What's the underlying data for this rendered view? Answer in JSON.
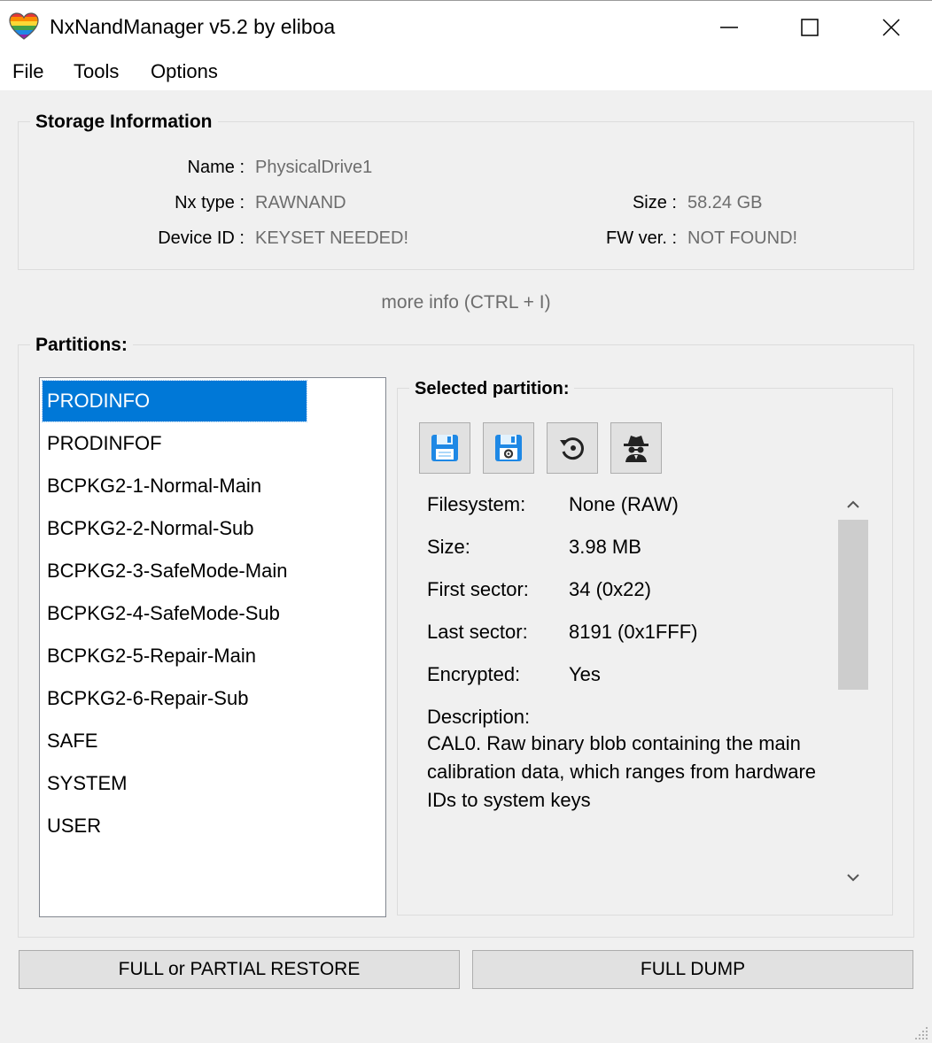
{
  "window": {
    "title": "NxNandManager v5.2 by eliboa",
    "icon": "rainbow-heart-icon"
  },
  "menu": {
    "items": [
      "File",
      "Tools",
      "Options"
    ]
  },
  "storage": {
    "title": "Storage Information",
    "name_label": "Name :",
    "name_value": "PhysicalDrive1",
    "nxtype_label": "Nx type :",
    "nxtype_value": "RAWNAND",
    "deviceid_label": "Device ID :",
    "deviceid_value": "KEYSET NEEDED!",
    "size_label": "Size :",
    "size_value": "58.24 GB",
    "fw_label": "FW ver. :",
    "fw_value": "NOT FOUND!"
  },
  "more_info": "more info (CTRL + I)",
  "partitions": {
    "title": "Partitions:",
    "items": [
      "PRODINFO",
      "PRODINFOF",
      "BCPKG2-1-Normal-Main",
      "BCPKG2-2-Normal-Sub",
      "BCPKG2-3-SafeMode-Main",
      "BCPKG2-4-SafeMode-Sub",
      "BCPKG2-5-Repair-Main",
      "BCPKG2-6-Repair-Sub",
      "SAFE",
      "SYSTEM",
      "USER"
    ],
    "selected_index": 0
  },
  "selected": {
    "title": "Selected partition:",
    "toolbar_icons": [
      "save-icon",
      "save-settings-icon",
      "restore-icon",
      "incognito-icon"
    ],
    "filesystem_label": "Filesystem:",
    "filesystem_value": "None (RAW)",
    "size_label": "Size:",
    "size_value": "3.98 MB",
    "first_label": "First sector:",
    "first_value": "34 (0x22)",
    "last_label": "Last sector:",
    "last_value": "8191 (0x1FFF)",
    "enc_label": "Encrypted:",
    "enc_value": "Yes",
    "desc_label": "Description:",
    "desc_value": "CAL0. Raw binary blob containing the main calibration data, which ranges from hardware IDs to system keys"
  },
  "buttons": {
    "restore": "FULL or PARTIAL RESTORE",
    "dump": "FULL DUMP"
  },
  "colors": {
    "accent": "#0078d7",
    "disk_blue": "#1e88e5"
  }
}
